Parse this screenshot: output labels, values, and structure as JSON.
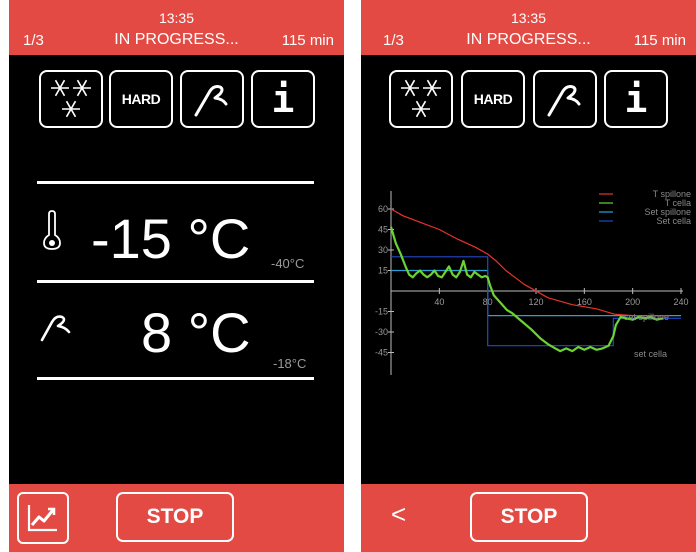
{
  "header": {
    "time": "13:35",
    "page": "1/3",
    "status": "IN PROGRESS...",
    "duration": "115 min"
  },
  "mode_icons": {
    "snowflakes": "snowflakes-icon",
    "hard": "HARD",
    "probe": "probe-icon",
    "info": "i"
  },
  "left": {
    "cell_temp": "-15 °C",
    "cell_setpoint": "-40°C",
    "probe_temp": "8 °C",
    "probe_setpoint": "-18°C"
  },
  "footer": {
    "stop_label": "STOP",
    "back_label": "<"
  },
  "colors": {
    "accent": "#e24a43",
    "t_spillone": "#e8322e",
    "t_cella": "#6bd434",
    "set_spillone": "#2aa0d8",
    "set_cella": "#2348c8"
  },
  "chart_data": {
    "type": "line",
    "x_ticks": [
      40,
      80,
      120,
      160,
      200,
      240
    ],
    "y_ticks": [
      60,
      45,
      30,
      15,
      -15,
      -30,
      -45
    ],
    "xlim": [
      0,
      240
    ],
    "ylim": [
      -55,
      62
    ],
    "legend": [
      "T spillone",
      "T cella",
      "Set spillone",
      "Set cella"
    ],
    "legend_position": "top-right",
    "annotations": [
      "set spillone",
      "set cella"
    ],
    "series": [
      {
        "name": "T spillone",
        "color": "#e8322e",
        "x": [
          0,
          10,
          25,
          40,
          55,
          70,
          80,
          87,
          95,
          110,
          130,
          150,
          170,
          185,
          200,
          210,
          230
        ],
        "y": [
          60,
          55,
          50,
          45,
          38,
          32,
          27,
          22,
          15,
          5,
          -5,
          -10,
          -13,
          -17,
          -18,
          -18,
          -18
        ]
      },
      {
        "name": "T cella",
        "color": "#6bd434",
        "x": [
          0,
          4,
          8,
          12,
          15,
          18,
          21,
          24,
          27,
          30,
          33,
          36,
          39,
          42,
          45,
          48,
          51,
          54,
          57,
          60,
          63,
          66,
          69,
          72,
          75,
          78,
          80,
          82,
          85,
          88,
          92,
          96,
          100,
          108,
          116,
          124,
          130,
          136,
          140,
          145,
          150,
          155,
          160,
          165,
          170,
          175,
          180,
          184,
          186,
          190,
          195,
          200,
          205,
          210,
          215,
          220,
          225
        ],
        "y": [
          47,
          35,
          27,
          18,
          12,
          10,
          13,
          15,
          12,
          10,
          12,
          15,
          11,
          10,
          14,
          18,
          12,
          10,
          14,
          22,
          12,
          10,
          14,
          12,
          10,
          11,
          10,
          4,
          -3,
          -6,
          -10,
          -14,
          -16,
          -22,
          -28,
          -35,
          -39,
          -42,
          -44,
          -42,
          -44,
          -41,
          -43,
          -41,
          -43,
          -42,
          -40,
          -33,
          -25,
          -19,
          -20,
          -21,
          -19,
          -20,
          -19,
          -21,
          -20
        ]
      },
      {
        "name": "Set spillone",
        "color": "#2aa0d8",
        "x": [
          0,
          80,
          80,
          240
        ],
        "y": [
          15,
          15,
          -18,
          -18
        ]
      },
      {
        "name": "Set cella",
        "color": "#2348c8",
        "x": [
          0,
          80,
          80,
          184,
          184,
          240
        ],
        "y": [
          25,
          25,
          -40,
          -40,
          -20,
          -20
        ]
      }
    ]
  }
}
